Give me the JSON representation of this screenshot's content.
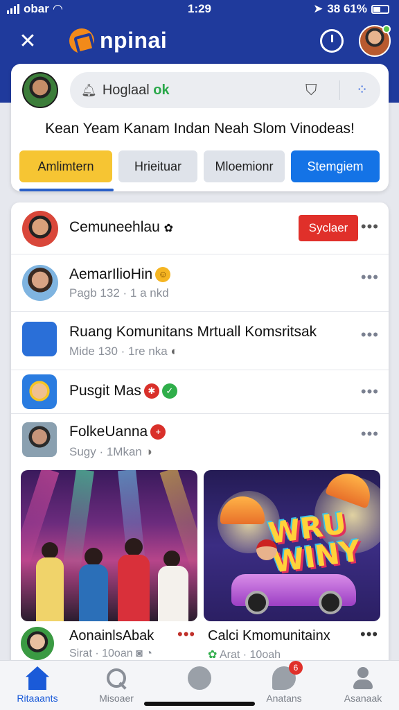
{
  "status_bar": {
    "carrier": "obar",
    "time": "1:29",
    "battery": "38 61%"
  },
  "header": {
    "app_name": "npinai"
  },
  "composer": {
    "search_text": "Hoglaal",
    "search_accent": "ok",
    "headline": "Kean Yeam Kanam Indan Neah Slom Vinodeas!",
    "chips": [
      "Amlimtern",
      "Hrieituar",
      "Mloemionr",
      "Stemgiem"
    ]
  },
  "feed": {
    "rows": [
      {
        "title": "Cemuneehlau",
        "subtitle": "",
        "button": "Syclaer"
      },
      {
        "title": "AemarIlioHin",
        "subtitle": "Pagb  132 · 1 a nkd"
      },
      {
        "title": "Ruang Komunitans Mrtuall Komsritsak",
        "subtitle": "Mide  130 · 1re nka"
      },
      {
        "title": "Pusgit Mas",
        "subtitle": ""
      },
      {
        "title": "FolkeUanna",
        "subtitle": "Sugy · 1Mkan"
      }
    ],
    "media": [
      {
        "title": "AonainlsAbak",
        "subtitle": "Sirat · 10oan"
      },
      {
        "title": "Calci Kmomunitainx",
        "subtitle": "Arat · 10oah",
        "art_text": "WRU WINY"
      }
    ]
  },
  "bottom_nav": {
    "tabs": [
      "Ritaaants",
      "Misoaer",
      "",
      "Anatans",
      "Asanaak"
    ],
    "chat_badge": "6"
  },
  "colors": {
    "header_bg": "#1f3a9c",
    "accent_blue": "#1473e6",
    "chip_yellow": "#f6c533",
    "follow_red": "#e0302a"
  }
}
